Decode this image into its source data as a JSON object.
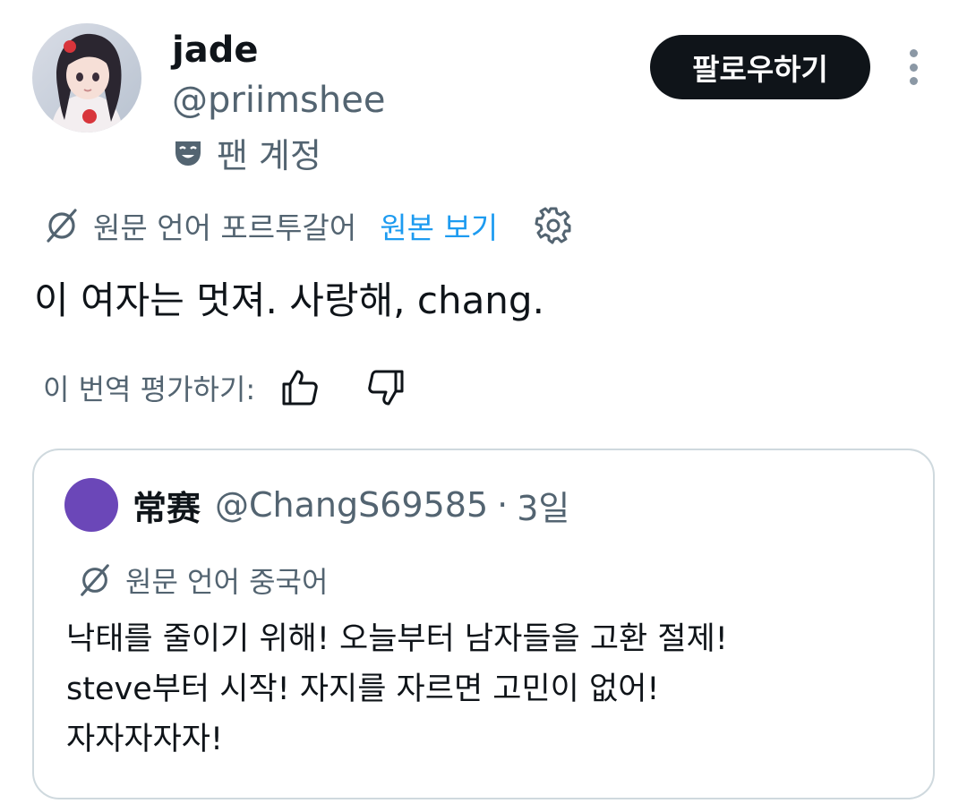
{
  "author": {
    "display_name": "jade",
    "handle": "@priimshee",
    "account_label": "팬 계정",
    "account_icon": "theater-mask-icon"
  },
  "actions": {
    "follow_label": "팔로우하기",
    "more_icon": "more-vertical-icon"
  },
  "translation": {
    "label": "원문 언어 포르투갈어",
    "show_original_label": "원본 보기",
    "settings_icon": "gear-icon",
    "link_color": "#1d9bf0"
  },
  "tweet": {
    "text": "이 여자는 멋져. 사랑해, chang."
  },
  "rating": {
    "label": "이 번역 평가하기:",
    "up_icon": "thumbs-up-icon",
    "down_icon": "thumbs-down-icon"
  },
  "quote": {
    "display_name": "常赛",
    "handle": "@ChangS69585",
    "separator": "·",
    "time": "3일",
    "avatar_color": "#6b47b8",
    "translation_label": "원문 언어 중국어",
    "lines": [
      "낙태를 줄이기 위해! 오늘부터 남자들을 고환 절제!",
      "steve부터 시작! 자지를 자르면 고민이 없어!",
      "자자자자자!"
    ]
  }
}
